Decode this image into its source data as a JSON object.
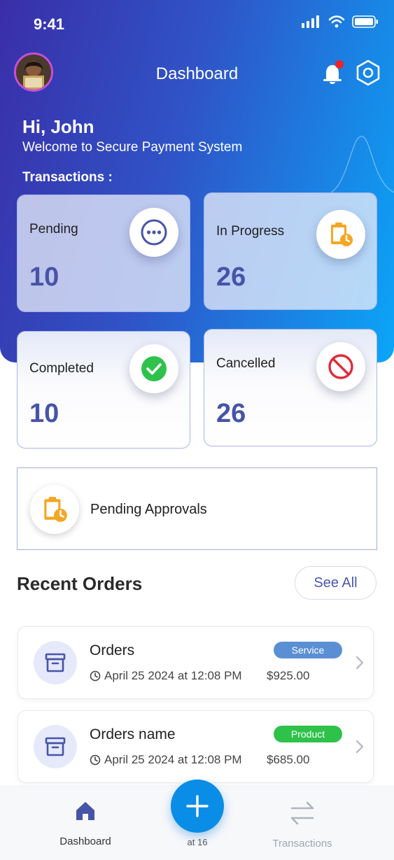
{
  "status_bar": {
    "time": "9:41"
  },
  "header": {
    "title": "Dashboard"
  },
  "greeting": {
    "hello": "Hi, John",
    "welcome": "Welcome to Secure Payment System",
    "section_label": "Transactions :"
  },
  "transactions": [
    {
      "label": "Pending",
      "value": "10",
      "icon": "more-dots-icon"
    },
    {
      "label": "In Progress",
      "value": "26",
      "icon": "clipboard-clock-icon"
    },
    {
      "label": "Completed",
      "value": "10",
      "icon": "check-circle-icon"
    },
    {
      "label": "Cancelled",
      "value": "26",
      "icon": "cancel-circle-icon"
    }
  ],
  "approvals": {
    "label": "Pending Approvals",
    "icon": "clipboard-clock-icon"
  },
  "recent_orders": {
    "title": "Recent Orders",
    "see_all": "See All",
    "items": [
      {
        "name": "Orders",
        "date": "April 25 2024 at 12:08 PM",
        "amount": "$925.00",
        "badge": "Service",
        "badge_color": "#5b8fd4"
      },
      {
        "name": "Orders name",
        "date": "April 25 2024 at 12:08 PM",
        "amount": "$685.00",
        "badge": "Product",
        "badge_color": "#2ec24a"
      }
    ]
  },
  "tabbar": {
    "items": [
      {
        "label": "Dashboard",
        "icon": "home-icon",
        "active": true
      },
      {
        "label": "Transactions",
        "icon": "transfer-arrows-icon",
        "active": false
      }
    ],
    "fab_icon": "plus-icon",
    "fab_label": "at 16"
  },
  "colors": {
    "primary": "#4654a8",
    "accent": "#0a8de6",
    "header_start": "#3a2ea8",
    "header_end": "#0aa6f8",
    "notification_dot": "#e8242e"
  }
}
